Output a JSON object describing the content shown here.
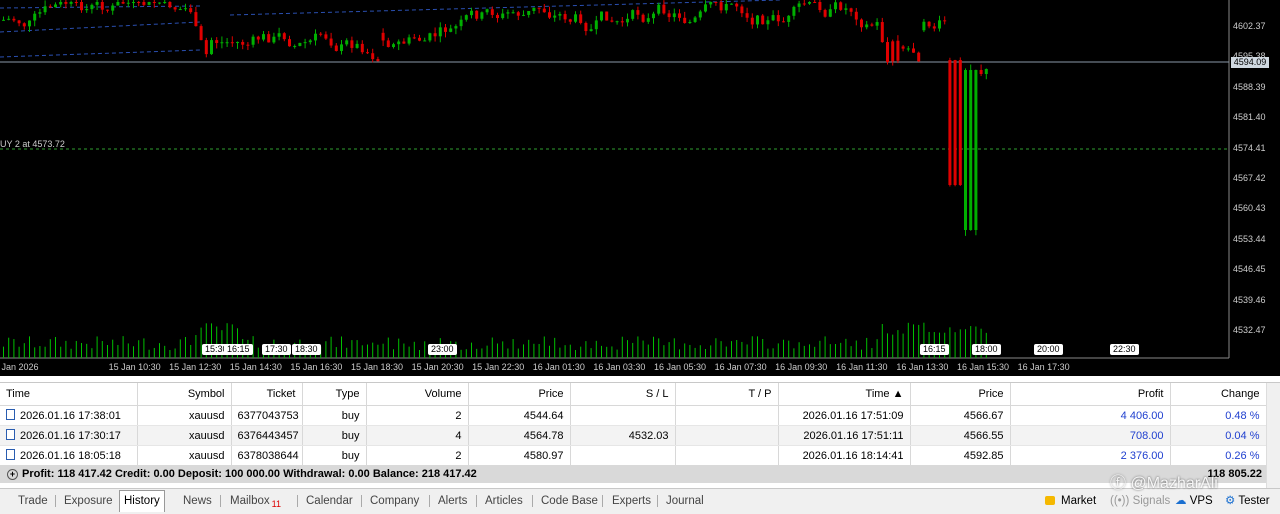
{
  "chart": {
    "price_labels": [
      "4602.37",
      "4595.38",
      "4588.39",
      "4581.40",
      "4574.41",
      "4567.42",
      "4560.43",
      "4553.44",
      "4546.45",
      "4539.46",
      "4532.47"
    ],
    "current_price": "4594.09",
    "order_label": "UY 2 at 4573.72",
    "time_labels": [
      "Jan 2026",
      "15 Jan 10:30",
      "15 Jan 12:30",
      "15 Jan 14:30",
      "15 Jan 16:30",
      "15 Jan 18:30",
      "15 Jan 20:30",
      "15 Jan 22:30",
      "16 Jan 01:30",
      "16 Jan 03:30",
      "16 Jan 05:30",
      "16 Jan 07:30",
      "16 Jan 09:30",
      "16 Jan 11:30",
      "16 Jan 13:30",
      "16 Jan 15:30",
      "16 Jan 17:30"
    ],
    "session_tags": [
      "15:30",
      "16:15",
      "17:30",
      "18:30",
      "23:00",
      "16:15",
      "18:00",
      "20:00",
      "22:30"
    ],
    "colors": {
      "background": "#000000",
      "bull": "#00a000",
      "bear": "#e00000",
      "grid_text": "#cccccc"
    }
  },
  "history": {
    "columns": [
      "Time",
      "Symbol",
      "Ticket",
      "Type",
      "Volume",
      "Price",
      "S / L",
      "T / P",
      "Time ▲",
      "Price",
      "Profit",
      "Change"
    ],
    "rows": [
      {
        "time": "2026.01.16 17:38:01",
        "symbol": "xauusd",
        "ticket": "6377043753",
        "type": "buy",
        "volume": "2",
        "price": "4544.64",
        "sl": "",
        "tp": "",
        "close_time": "2026.01.16 17:51:09",
        "close_price": "4566.67",
        "profit": "4 406.00",
        "change": "0.48 %"
      },
      {
        "time": "2026.01.16 17:30:17",
        "symbol": "xauusd",
        "ticket": "6376443457",
        "type": "buy",
        "volume": "4",
        "price": "4564.78",
        "sl": "4532.03",
        "tp": "",
        "close_time": "2026.01.16 17:51:11",
        "close_price": "4566.55",
        "profit": "708.00",
        "change": "0.04 %"
      },
      {
        "time": "2026.01.16 18:05:18",
        "symbol": "xauusd",
        "ticket": "6378038644",
        "type": "buy",
        "volume": "2",
        "price": "4580.97",
        "sl": "",
        "tp": "",
        "close_time": "2026.01.16 18:14:41",
        "close_price": "4592.85",
        "profit": "2 376.00",
        "change": "0.26 %"
      }
    ],
    "summary": "Profit: 118 417.42  Credit: 0.00  Deposit: 100 000.00  Withdrawal: 0.00  Balance: 218 417.42",
    "total": "118 805.22"
  },
  "tabs": [
    "Trade",
    "Exposure",
    "History",
    "News",
    "Mailbox",
    "Calendar",
    "Company",
    "Alerts",
    "Articles",
    "Code Base",
    "Experts",
    "Journal"
  ],
  "active_tab": "History",
  "mailbox_badge": "11",
  "status": {
    "market": "Market",
    "signals": "Signals",
    "vps": "VPS",
    "tester": "Tester"
  },
  "watermark": "@MazharAli"
}
